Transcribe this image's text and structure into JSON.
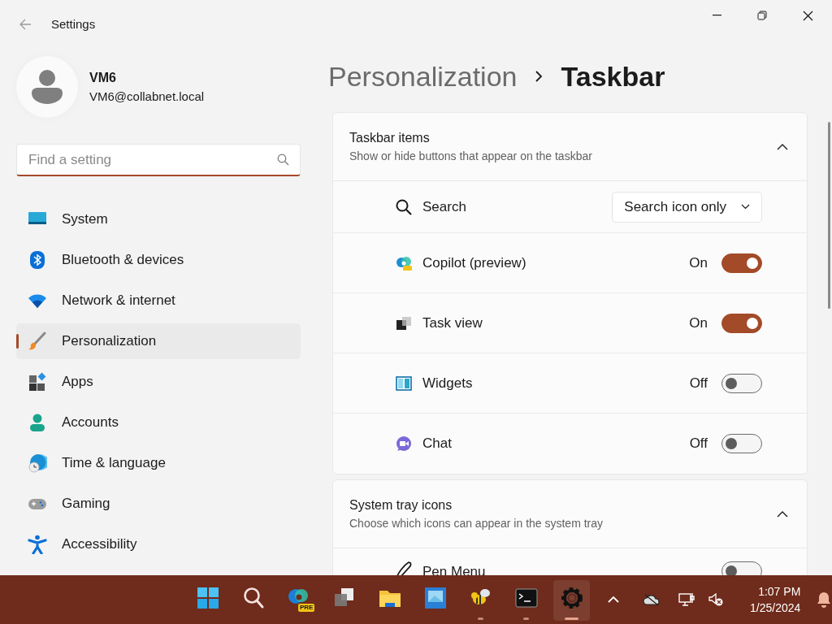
{
  "window": {
    "title": "Settings"
  },
  "user": {
    "name": "VM6",
    "email": "VM6@collabnet.local"
  },
  "search": {
    "placeholder": "Find a setting"
  },
  "nav": [
    {
      "label": "System",
      "selected": false
    },
    {
      "label": "Bluetooth & devices",
      "selected": false
    },
    {
      "label": "Network & internet",
      "selected": false
    },
    {
      "label": "Personalization",
      "selected": true
    },
    {
      "label": "Apps",
      "selected": false
    },
    {
      "label": "Accounts",
      "selected": false
    },
    {
      "label": "Time & language",
      "selected": false
    },
    {
      "label": "Gaming",
      "selected": false
    },
    {
      "label": "Accessibility",
      "selected": false
    }
  ],
  "breadcrumb": {
    "parent": "Personalization",
    "current": "Taskbar"
  },
  "sections": [
    {
      "title": "Taskbar items",
      "subtitle": "Show or hide buttons that appear on the taskbar",
      "expanded": true,
      "rows": [
        {
          "kind": "dropdown",
          "label": "Search",
          "value": "Search icon only"
        },
        {
          "kind": "toggle",
          "label": "Copilot (preview)",
          "on": true,
          "state_text": "On"
        },
        {
          "kind": "toggle",
          "label": "Task view",
          "on": true,
          "state_text": "On"
        },
        {
          "kind": "toggle",
          "label": "Widgets",
          "on": false,
          "state_text": "Off"
        },
        {
          "kind": "toggle",
          "label": "Chat",
          "on": false,
          "state_text": "Off"
        }
      ]
    },
    {
      "title": "System tray icons",
      "subtitle": "Choose which icons can appear in the system tray",
      "expanded": true,
      "rows": [
        {
          "kind": "toggle",
          "label": "Pen Menu",
          "on": false
        }
      ]
    }
  ],
  "taskbar": {
    "apps": [
      {
        "running": false,
        "selected": false
      },
      {
        "running": false,
        "selected": false
      },
      {
        "running": false,
        "selected": false,
        "badge": "PRE"
      },
      {
        "running": false,
        "selected": false
      },
      {
        "running": false,
        "selected": false
      },
      {
        "running": false,
        "selected": false
      },
      {
        "running": true,
        "selected": false
      },
      {
        "running": true,
        "selected": false
      },
      {
        "running": true,
        "selected": true
      }
    ],
    "clock": {
      "time": "1:07 PM",
      "date": "1/25/2024"
    }
  }
}
